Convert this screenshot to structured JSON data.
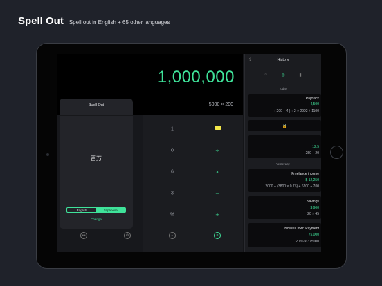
{
  "headline": {
    "title": "Spell Out",
    "subtitle": "Spell out in English + 65 other languages"
  },
  "display": {
    "result": "1,000,000",
    "expression": "5000 × 200"
  },
  "keypad": {
    "left_column": [
      "1",
      "0",
      "6",
      "3",
      "%"
    ],
    "ops": [
      "÷",
      "×",
      "−",
      "+"
    ]
  },
  "popup": {
    "title": "Spell Out",
    "word": "百万",
    "options": [
      "English",
      "Japanese"
    ],
    "selected": "Japanese",
    "change_label": "Change"
  },
  "bottom_icons": [
    "more-icon",
    "settings-icon",
    "minus-icon",
    "equals-icon"
  ],
  "history": {
    "title": "History",
    "tabs": [
      "clock-icon",
      "check-icon",
      "bookmark-icon"
    ],
    "sections": {
      "today": "Today",
      "yesterday": "Yesterday"
    },
    "cards": [
      {
        "name": "Payback",
        "value": "4,500",
        "calc": "( 200 + 4 ) ÷ 2 × 2992 + 1100"
      },
      {
        "name": "",
        "value": "",
        "calc": "",
        "locked": true
      },
      {
        "name": "",
        "value": "12.5",
        "calc": "250 ÷ 20"
      },
      {
        "name": "Freelance income",
        "value": "$ 12,250",
        "calc": "...2000 + (3800 × 0.75) + 6200 + 700"
      },
      {
        "name": "Savings",
        "value": "$ 900",
        "calc": "20 × 45"
      },
      {
        "name": "House Down Payment",
        "value": "75,000",
        "calc": "20 % × 375000"
      }
    ]
  },
  "colors": {
    "accent": "#3fe39a",
    "background": "#1f222a",
    "marker": "#f4e84a"
  }
}
